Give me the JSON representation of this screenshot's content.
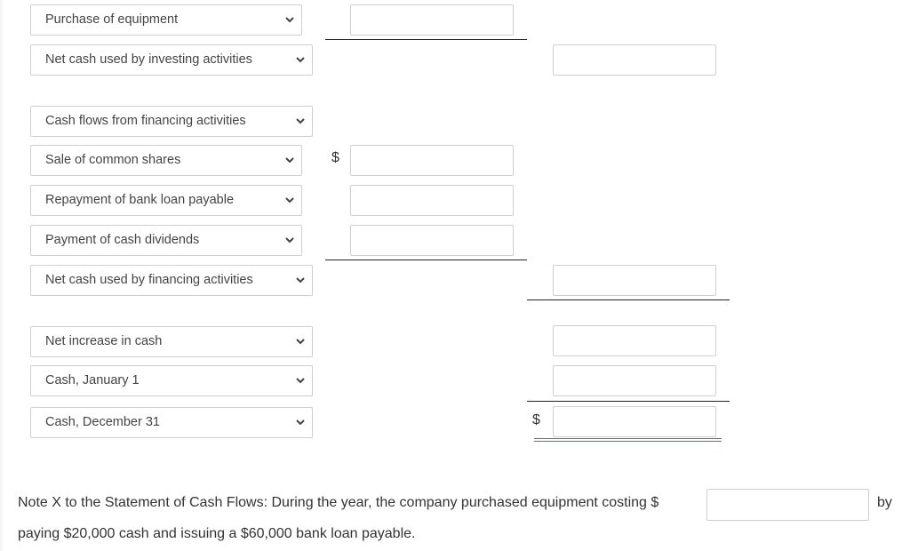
{
  "rows": [
    {
      "label": "Purchase of equipment"
    },
    {
      "label": "Net cash used by investing activities"
    },
    {
      "label": "Cash flows from financing activities"
    },
    {
      "label": "Sale of common shares"
    },
    {
      "label": "Repayment of bank loan payable"
    },
    {
      "label": "Payment of cash dividends"
    },
    {
      "label": "Net cash used by financing activities"
    },
    {
      "label": "Net increase in cash"
    },
    {
      "label": "Cash, January 1"
    },
    {
      "label": "Cash, December 31"
    }
  ],
  "inputs": {
    "purchase_of_equipment": "",
    "net_cash_investing": "",
    "sale_of_common_shares": "",
    "repayment_of_bank_loan": "",
    "payment_of_dividends": "",
    "net_cash_financing": "",
    "net_increase_in_cash": "",
    "cash_january_1": "",
    "cash_december_31": ""
  },
  "currency_symbol": "$",
  "note": {
    "line1": "Note X to the Statement of Cash Flows: During the year, the company purchased equipment costing $",
    "input_value": "",
    "after_input": "by",
    "line2": "paying $20,000 cash and issuing a $60,000 bank loan payable."
  }
}
